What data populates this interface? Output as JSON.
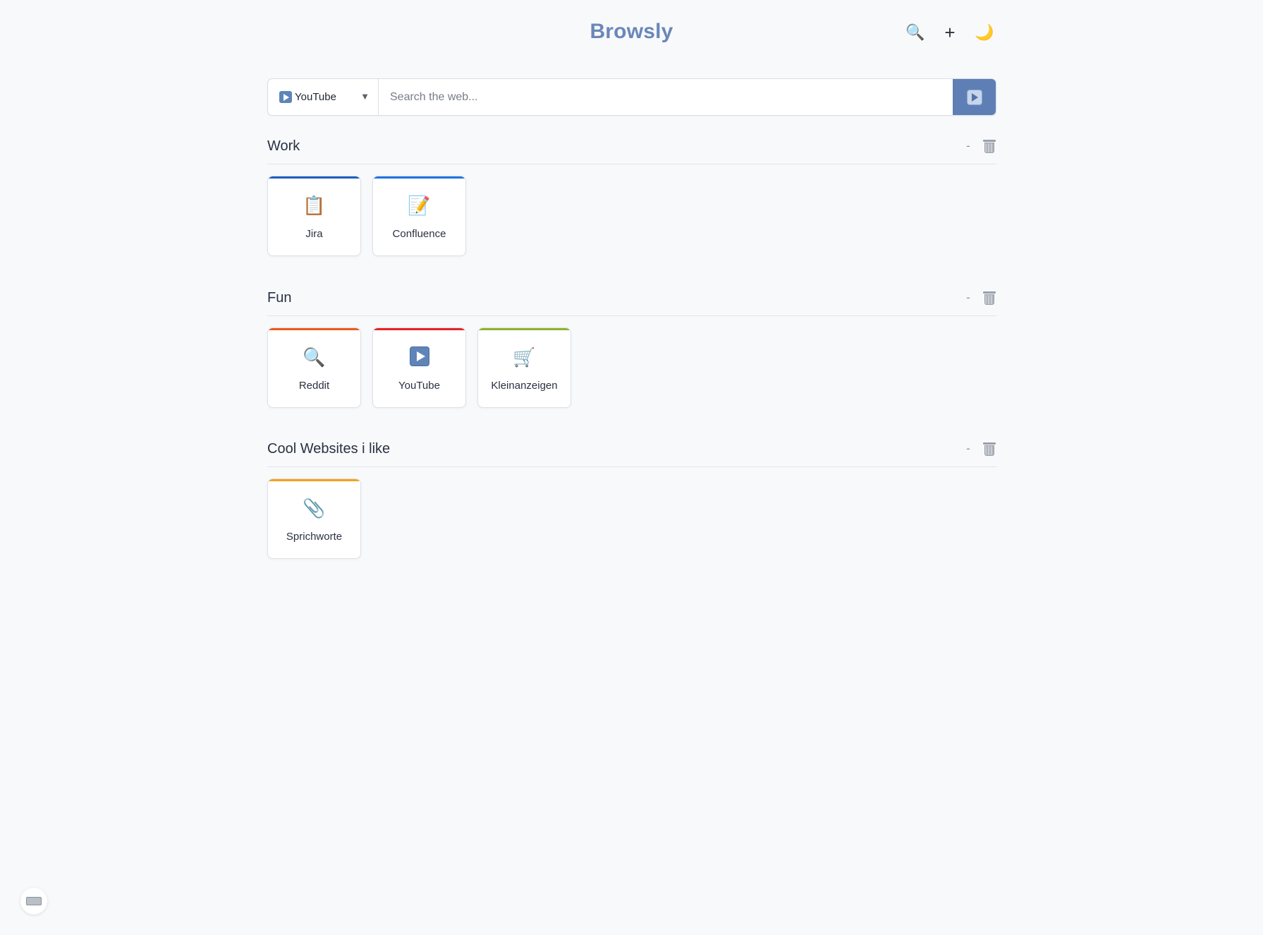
{
  "app": {
    "title": "Browsly"
  },
  "header": {
    "actions": [
      {
        "name": "search-toggle",
        "icon": "magnifier-icon",
        "glyph": "🔍"
      },
      {
        "name": "add",
        "icon": "plus-icon",
        "glyph": "+"
      },
      {
        "name": "theme",
        "icon": "moon-icon",
        "glyph": "🌙"
      }
    ]
  },
  "search": {
    "engine_label": "YouTube",
    "engine_icon": "youtube-play-icon",
    "caret": "▼",
    "placeholder": "Search the web...",
    "value": "",
    "submit_icon": "youtube-play-icon",
    "submit_color": "#5e7fb5"
  },
  "sections": [
    {
      "title": "Work",
      "collapse_label": "-",
      "tiles": [
        {
          "label": "Jira",
          "icon": "clipboard-icon",
          "glyph": "📋",
          "color": "#1d5fbf"
        },
        {
          "label": "Confluence",
          "icon": "memo-icon",
          "glyph": "📝",
          "color": "#1f73e0"
        }
      ]
    },
    {
      "title": "Fun",
      "collapse_label": "-",
      "tiles": [
        {
          "label": "Reddit",
          "icon": "magnifier-icon",
          "glyph": "🔍",
          "color": "#ec5a1c"
        },
        {
          "label": "YouTube",
          "icon": "youtube-play-icon",
          "glyph": "",
          "color": "#e32525"
        },
        {
          "label": "Kleinanzeigen",
          "icon": "shopping-cart-icon",
          "glyph": "🛒",
          "color": "#8cb42a"
        }
      ]
    },
    {
      "title": "Cool Websites i like",
      "collapse_label": "-",
      "tiles": [
        {
          "label": "Sprichworte",
          "icon": "paperclip-icon",
          "glyph": "📎",
          "color": "#f3a21c"
        }
      ]
    }
  ],
  "footer": {
    "keyboard_icon": "keyboard-icon"
  },
  "colors": {
    "brand": "#6a87b8",
    "background": "#f8f9fb"
  }
}
